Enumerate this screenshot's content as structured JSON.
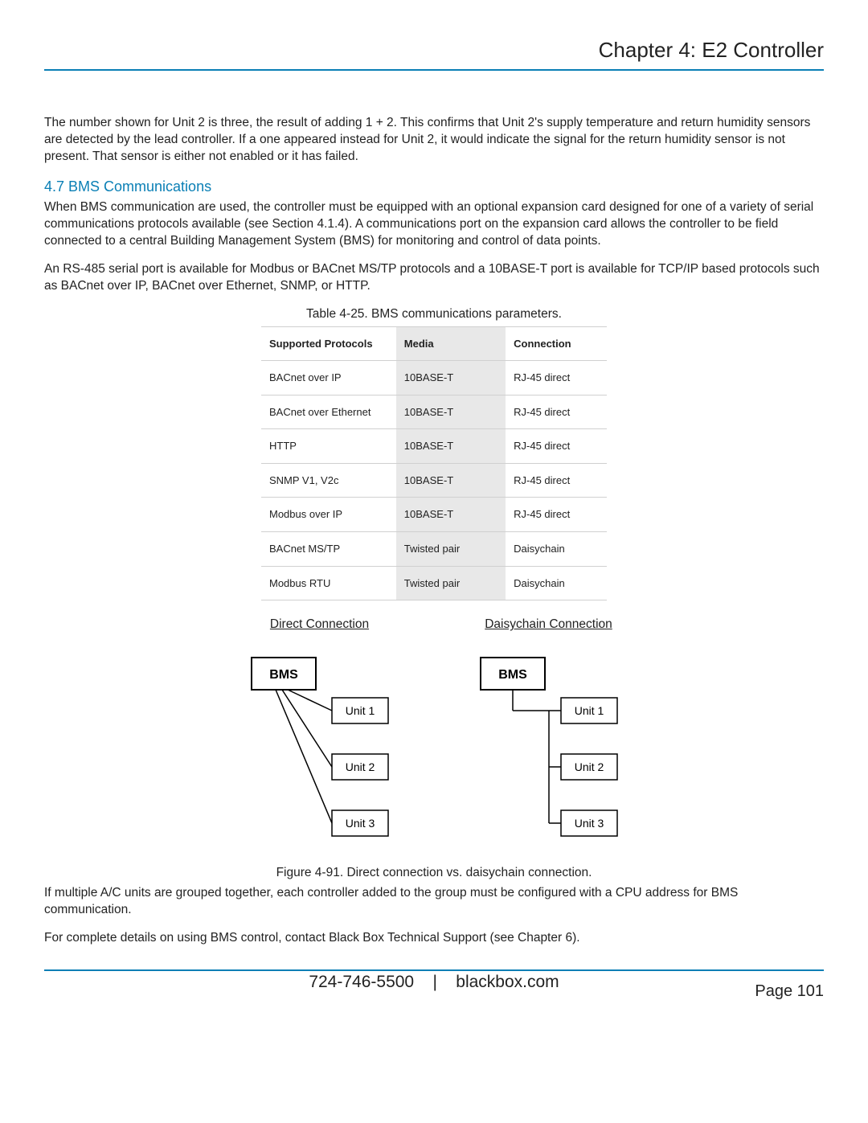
{
  "header": {
    "title": "Chapter 4: E2 Controller"
  },
  "intro_para": "The number shown for Unit 2 is three, the result of adding 1 + 2. This confirms that Unit 2's supply temperature and return humidity sensors are detected by the lead controller. If a one appeared instead for Unit 2, it would indicate the signal for the return humidity sensor is not present. That sensor is either not enabled or it has failed.",
  "section": {
    "heading": "4.7 BMS Communications",
    "p1": "When BMS communication are used, the controller must be equipped with an optional expansion card designed for one of a variety of serial communications protocols available (see Section 4.1.4). A communications port on the expansion card allows the controller to be field connected to a central Building Management System (BMS) for monitoring and control of data points.",
    "p2": "An RS-485 serial port is available for Modbus or BACnet MS/TP protocols and a 10BASE-T port is available for TCP/IP based protocols such as BACnet over IP, BACnet over Ethernet, SNMP, or HTTP."
  },
  "table": {
    "caption": "Table 4-25. BMS communications parameters.",
    "headers": {
      "c1": "Supported Protocols",
      "c2": "Media",
      "c3": "Connection"
    },
    "rows": [
      {
        "c1": "BACnet over IP",
        "c2": "10BASE-T",
        "c3": "RJ-45 direct"
      },
      {
        "c1": "BACnet over Ethernet",
        "c2": "10BASE-T",
        "c3": "RJ-45 direct"
      },
      {
        "c1": "HTTP",
        "c2": "10BASE-T",
        "c3": "RJ-45 direct"
      },
      {
        "c1": "SNMP V1, V2c",
        "c2": "10BASE-T",
        "c3": "RJ-45 direct"
      },
      {
        "c1": "Modbus over IP",
        "c2": "10BASE-T",
        "c3": "RJ-45 direct"
      },
      {
        "c1": "BACnet MS/TP",
        "c2": "Twisted pair",
        "c3": "Daisychain"
      },
      {
        "c1": "Modbus RTU",
        "c2": "Twisted pair",
        "c3": "Daisychain"
      }
    ]
  },
  "diagram": {
    "direct_title": "Direct Connection",
    "daisy_title": "Daisychain Connection",
    "bms": "BMS",
    "unit1": "Unit 1",
    "unit2": "Unit 2",
    "unit3": "Unit 3",
    "caption": "Figure 4-91. Direct connection vs. daisychain connection."
  },
  "closing": {
    "p1": "If multiple A/C units are grouped together, each controller added to the group must be configured with a CPU address for BMS communication.",
    "p2": "For complete details on using BMS control, contact Black Box Technical Support (see Chapter 6)."
  },
  "footer": {
    "phone": "724-746-5500",
    "sep": "|",
    "site": "blackbox.com",
    "page": "Page 101"
  }
}
